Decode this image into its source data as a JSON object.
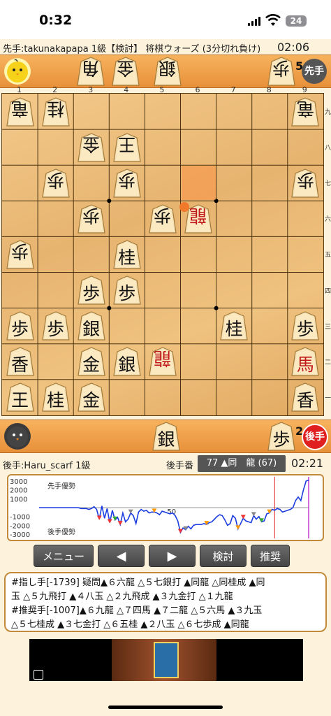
{
  "status_bar": {
    "time": "0:32",
    "battery": "24"
  },
  "header": {
    "sente_player": "先手:takunakapapa 1級【検討】 将棋ウォーズ (3分切れ負け)",
    "sente_clock": "02:06"
  },
  "top_hand": {
    "pieces": [
      {
        "char": "角",
        "col": 0
      },
      {
        "char": "金",
        "col": 1
      },
      {
        "char": "銀",
        "col": 2
      },
      {
        "char": "歩",
        "col": 3
      }
    ],
    "pawn_count": "5",
    "turn_badge": "先手"
  },
  "board": {
    "file_labels": [
      "1",
      "2",
      "3",
      "4",
      "5",
      "6",
      "7",
      "8",
      "9"
    ],
    "rank_labels": [
      "九",
      "八",
      "七",
      "六",
      "五",
      "四",
      "三",
      "二",
      "一"
    ],
    "pieces": [
      {
        "char": "竜",
        "row": 0,
        "col": 0,
        "side": "gote"
      },
      {
        "char": "桂",
        "row": 0,
        "col": 1,
        "side": "gote"
      },
      {
        "char": "竜",
        "row": 0,
        "col": 8,
        "side": "gote"
      },
      {
        "char": "金",
        "row": 1,
        "col": 2,
        "side": "gote"
      },
      {
        "char": "王",
        "row": 1,
        "col": 3,
        "side": "gote"
      },
      {
        "char": "歩",
        "row": 2,
        "col": 1,
        "side": "gote"
      },
      {
        "char": "歩",
        "row": 2,
        "col": 3,
        "side": "gote"
      },
      {
        "char": "歩",
        "row": 2,
        "col": 8,
        "side": "gote"
      },
      {
        "char": "歩",
        "row": 3,
        "col": 2,
        "side": "gote"
      },
      {
        "char": "歩",
        "row": 3,
        "col": 4,
        "side": "gote"
      },
      {
        "char": "龍",
        "row": 3,
        "col": 5,
        "side": "gote",
        "promoted": true
      },
      {
        "char": "歩",
        "row": 4,
        "col": 0,
        "side": "gote"
      },
      {
        "char": "桂",
        "row": 4,
        "col": 3,
        "side": "sente"
      },
      {
        "char": "歩",
        "row": 5,
        "col": 2,
        "side": "sente"
      },
      {
        "char": "歩",
        "row": 5,
        "col": 3,
        "side": "sente"
      },
      {
        "char": "歩",
        "row": 6,
        "col": 0,
        "side": "sente"
      },
      {
        "char": "歩",
        "row": 6,
        "col": 1,
        "side": "sente"
      },
      {
        "char": "銀",
        "row": 6,
        "col": 2,
        "side": "sente"
      },
      {
        "char": "桂",
        "row": 6,
        "col": 6,
        "side": "sente"
      },
      {
        "char": "歩",
        "row": 6,
        "col": 8,
        "side": "sente"
      },
      {
        "char": "香",
        "row": 7,
        "col": 0,
        "side": "sente"
      },
      {
        "char": "金",
        "row": 7,
        "col": 2,
        "side": "sente"
      },
      {
        "char": "銀",
        "row": 7,
        "col": 3,
        "side": "sente"
      },
      {
        "char": "龍",
        "row": 7,
        "col": 4,
        "side": "gote",
        "promoted": true
      },
      {
        "char": "馬",
        "row": 7,
        "col": 8,
        "side": "sente",
        "promoted": true
      },
      {
        "char": "王",
        "row": 8,
        "col": 0,
        "side": "sente"
      },
      {
        "char": "桂",
        "row": 8,
        "col": 1,
        "side": "sente"
      },
      {
        "char": "金",
        "row": 8,
        "col": 2,
        "side": "sente"
      },
      {
        "char": "香",
        "row": 8,
        "col": 8,
        "side": "sente"
      }
    ],
    "last_move": {
      "from_row": 2,
      "from_col": 5,
      "to_row": 3,
      "to_col": 5
    }
  },
  "bottom_hand": {
    "pieces": [
      {
        "char": "銀",
        "col": 0
      },
      {
        "char": "歩",
        "col": 1
      }
    ],
    "pawn_count": "2",
    "turn_badge": "後手"
  },
  "info": {
    "gote_player": "後手:Haru_scarf 1級",
    "turn_label": "後手番",
    "move_text": "77 ▲同　龍 (67)",
    "gote_clock": "02:21"
  },
  "graph": {
    "label_sente": "先手優勢",
    "label_gote": "後手優勢",
    "y_ticks": [
      "3000",
      "2000",
      "1000",
      "-1000",
      "-2000",
      "-3000"
    ],
    "mid_label": "50",
    "ylim": [
      -3000,
      3000
    ],
    "series": [
      0,
      0,
      0,
      0,
      0,
      0,
      0,
      0,
      0,
      0,
      0,
      0,
      0,
      0,
      0,
      0,
      -100,
      -100,
      -100,
      -200,
      -100,
      100,
      -200,
      -1300,
      200,
      -1200,
      -100,
      -1700,
      -300,
      -1400,
      -1100,
      -1900,
      -600,
      -1600,
      -1300,
      -600,
      -900,
      -1800,
      -500,
      -200,
      -400,
      -300,
      -600,
      -500,
      -500,
      -600,
      -800,
      -400,
      -500,
      -600,
      -700,
      -600,
      -900,
      -1500,
      -2800,
      -2300,
      -2500,
      -2100,
      -2400,
      -2000,
      -1900,
      -1900,
      -1900,
      -1800,
      -1900,
      -1700,
      -1600,
      -1300,
      -1000,
      -800,
      -900,
      -1400,
      -2000,
      -1800,
      -900,
      -1200,
      -2400,
      -1800,
      -1200,
      -1500,
      -1600,
      -1700,
      -900,
      -1300,
      -1000,
      -1600,
      -1500,
      -700,
      -600,
      -200,
      -300,
      -100,
      -200,
      -500,
      -400,
      -300,
      -200,
      0,
      800,
      1200,
      800,
      2000,
      3000,
      3100
    ],
    "markers": [
      {
        "i": 23,
        "color": "#e33"
      },
      {
        "i": 27,
        "color": "#e33"
      },
      {
        "i": 29,
        "color": "#3a3"
      },
      {
        "i": 31,
        "color": "#e33"
      },
      {
        "i": 35,
        "color": "#888"
      },
      {
        "i": 44,
        "color": "#f90"
      },
      {
        "i": 54,
        "color": "#e33"
      },
      {
        "i": 56,
        "color": "#888"
      },
      {
        "i": 64,
        "color": "#f90"
      },
      {
        "i": 76,
        "color": "#f90"
      },
      {
        "i": 78,
        "color": "#e33"
      },
      {
        "i": 82,
        "color": "#888"
      },
      {
        "i": 85,
        "color": "#3a3"
      },
      {
        "i": 88,
        "color": "#f90"
      }
    ],
    "cursor_red_index": 90,
    "cursor_magenta_index": 103
  },
  "buttons": {
    "menu": "メニュー",
    "prev": "◀",
    "next": "▶",
    "analyze": "検討",
    "recommend": "推奨"
  },
  "comment": {
    "line1": "#指し手[-1739] 疑問▲６六龍 △５七銀打 ▲同龍 △同桂成 ▲同",
    "line2": "玉 △５九飛打 ▲４八玉 △２九飛成 ▲３九金打 △１九龍",
    "line3": "#推奨手[-1007]▲６九龍 △７四馬 ▲７二龍 △５六馬 ▲３九玉",
    "line4": "△５七桂成 ▲３七金打 △６五桂 ▲２八玉 △６七歩成 ▲同龍"
  }
}
